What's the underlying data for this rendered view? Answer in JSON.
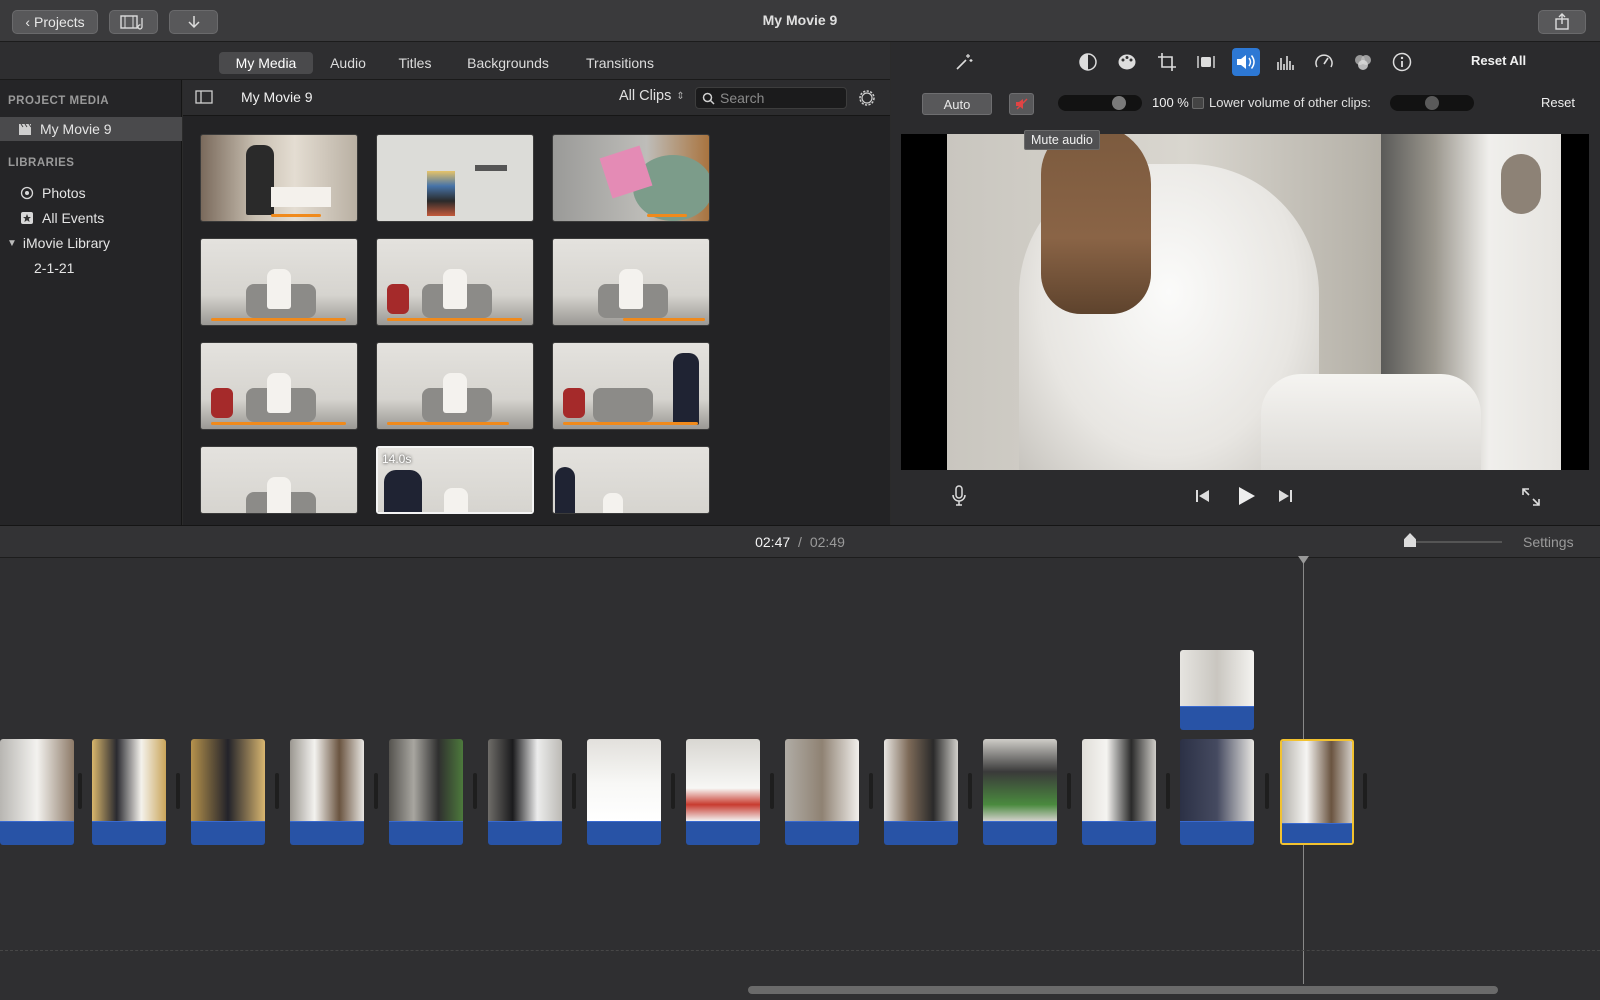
{
  "window": {
    "title": "My Movie 9",
    "projects_label": "Projects"
  },
  "media_tabs": [
    "My Media",
    "Audio",
    "Titles",
    "Backgrounds",
    "Transitions"
  ],
  "sidebar": {
    "project_media_header": "PROJECT MEDIA",
    "project_item": "My Movie 9",
    "libraries_header": "LIBRARIES",
    "library_items": [
      "Photos",
      "All Events",
      "iMovie Library",
      "2-1-21"
    ]
  },
  "browser": {
    "title": "My Movie 9",
    "filter": "All Clips",
    "search_placeholder": "Search",
    "hovered_duration": "14.0s"
  },
  "viewer": {
    "auto_label": "Auto",
    "volume_percent": "100 %",
    "volume_level": 1.0,
    "lower_volume_label": "Lower volume of other clips:",
    "reset_label": "Reset",
    "reset_all_label": "Reset All",
    "tooltip": "Mute audio",
    "active_tool": "volume-icon"
  },
  "timeline": {
    "current_time": "02:47",
    "separator": "/",
    "total_time": "02:49",
    "settings_label": "Settings"
  },
  "colors": {
    "accent": "#2d78d4",
    "used_range": "#f08a1c",
    "audio_track": "#2853a6",
    "selected_clip_border": "#f2c230"
  }
}
